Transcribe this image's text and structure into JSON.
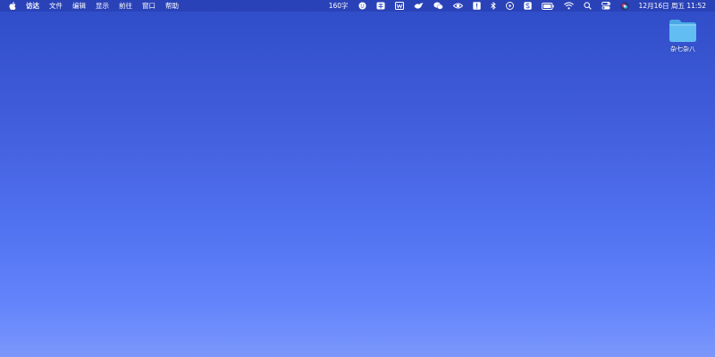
{
  "menubar": {
    "app_name": "访达",
    "menus": [
      "文件",
      "编辑",
      "显示",
      "前往",
      "窗口",
      "帮助"
    ],
    "word_count": "160字",
    "datetime": "12月16日 周五  11:52",
    "status_icons": [
      "smiley-icon",
      "input-method-icon",
      "wps-icon",
      "bird-icon",
      "wechat-icon",
      "eye-icon",
      "exclamation-icon",
      "bluetooth-icon",
      "play-icon",
      "s-app-icon",
      "battery-icon",
      "wifi-icon",
      "search-icon",
      "control-center-icon",
      "siri-icon"
    ]
  },
  "desktop": {
    "folder_label": "杂七杂八"
  },
  "colors": {
    "wallpaper_top": "#2f4cc7",
    "wallpaper_bottom": "#7b97fb",
    "folder": "#5bb8f0"
  }
}
